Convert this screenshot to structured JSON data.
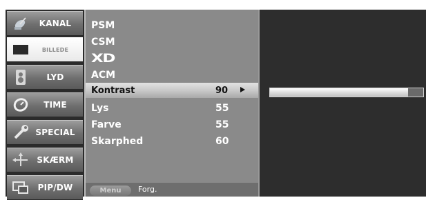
{
  "tabs": [
    {
      "label": "KANAL",
      "icon": "channel-satellite-icon",
      "active": false
    },
    {
      "label": "BILLEDE",
      "icon": "picture-screen-icon",
      "active": true
    },
    {
      "label": "LYD",
      "icon": "speaker-icon",
      "active": false
    },
    {
      "label": "TIME",
      "icon": "clock-icon",
      "active": false
    },
    {
      "label": "SPECIAL",
      "icon": "wrench-icon",
      "active": false
    },
    {
      "label": "SKÆRM",
      "icon": "screen-arrows-icon",
      "active": false
    },
    {
      "label": "PIP/DW",
      "icon": "pip-windows-icon",
      "active": false
    }
  ],
  "menu": {
    "items": [
      {
        "name": "PSM",
        "value": ""
      },
      {
        "name": "CSM",
        "value": ""
      },
      {
        "name": "XD",
        "value": ""
      },
      {
        "name": "ACM",
        "value": ""
      },
      {
        "name": "Kontrast",
        "value": "90",
        "selected": true
      },
      {
        "name": "Lys",
        "value": "55"
      },
      {
        "name": "Farve",
        "value": "55"
      },
      {
        "name": "Skarphed",
        "value": "60"
      }
    ],
    "footer": {
      "button": "Menu",
      "hint": "Forg."
    }
  },
  "slider": {
    "name": "Kontrast",
    "value": 90,
    "max": 100
  },
  "colors": {
    "panel": "#8a8a8a",
    "selected": "#d0d0d0",
    "background": "#2d2d2d"
  }
}
